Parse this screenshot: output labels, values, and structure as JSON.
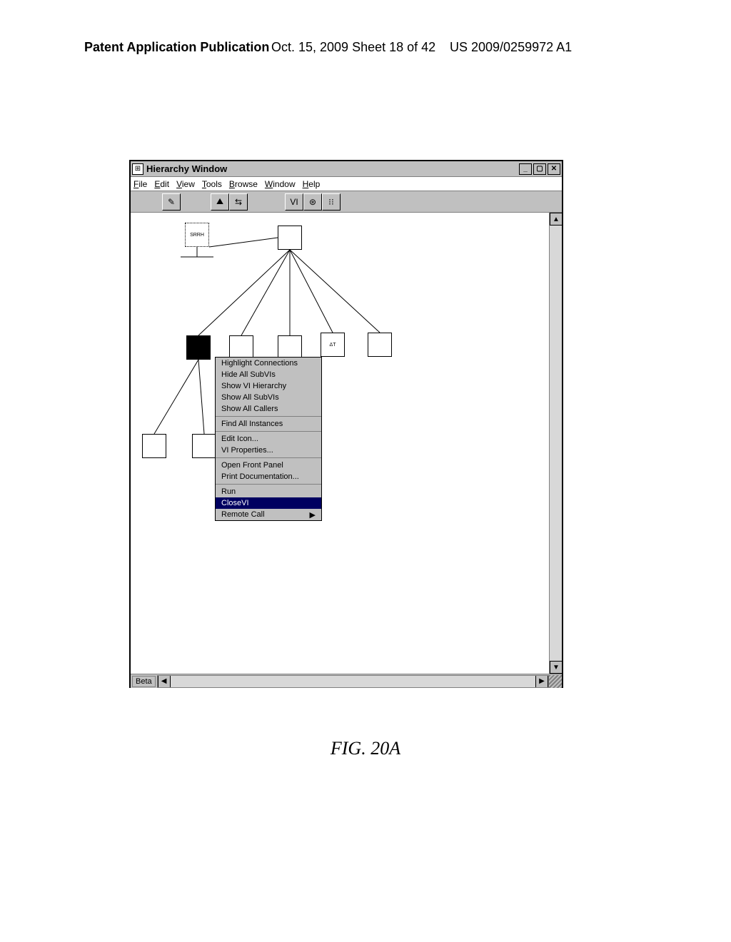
{
  "header": {
    "left": "Patent Application Publication",
    "center": "Oct. 15, 2009   Sheet 18 of 42",
    "right": "US 2009/0259972 A1"
  },
  "figure_caption": "FIG. 20A",
  "window": {
    "title": "Hierarchy Window",
    "minimize": "_",
    "maximize": "▢",
    "close": "✕"
  },
  "menubar": {
    "file": "File",
    "edit": "Edit",
    "view": "View",
    "tools": "Tools",
    "browse": "Browse",
    "window": "Window",
    "help": "Help"
  },
  "toolbar": {
    "btn_brush": "✎",
    "btn_tree1": "⛰",
    "btn_tree2": "⇆",
    "btn_vi": "VI",
    "btn_globe": "⊛",
    "btn_layout": "⁝⁝"
  },
  "statusbar": {
    "label": "Beta",
    "arrow_left": "◀",
    "arrow_right": "▶",
    "arrow_up": "▲",
    "arrow_down": "▼"
  },
  "context_menu": {
    "highlight": "Highlight Connections",
    "hide_subvis": "Hide All SubVIs",
    "show_hierarchy": "Show VI Hierarchy",
    "show_subvis": "Show All SubVIs",
    "show_callers": "Show All Callers",
    "find_instances": "Find All Instances",
    "edit_icon": "Edit Icon...",
    "vi_properties": "VI Properties...",
    "open_front": "Open Front Panel",
    "print_doc": "Print Documentation...",
    "run": "Run",
    "close_vi": "CloseVI",
    "remote_call": "Remote Call",
    "submenu_arrow": "▶"
  },
  "vi_icons": {
    "top1": "SRRH",
    "top2": "",
    "mid1": "",
    "mid2": "",
    "mid3": "",
    "mid4": "ΔT",
    "mid5": "",
    "bot1": "",
    "bot2": ""
  }
}
